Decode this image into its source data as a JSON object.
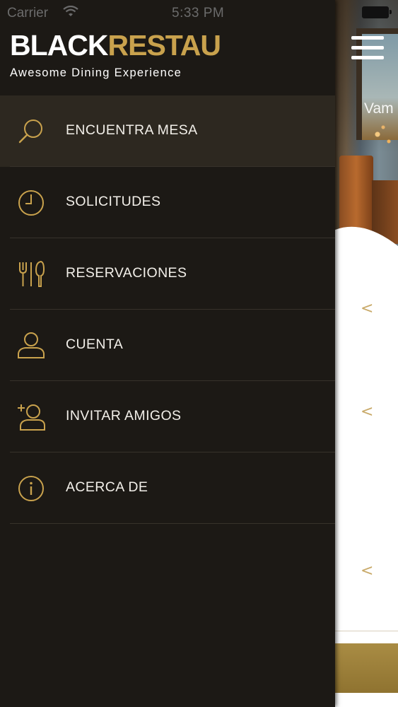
{
  "status_bar": {
    "carrier": "Carrier",
    "time": "5:33 PM"
  },
  "brand": {
    "logo_part1": "BLACK",
    "logo_part2": "RESTAU",
    "tagline": "Awesome Dining Experience",
    "colors": {
      "white": "#ffffff",
      "gold": "#c9a24d"
    }
  },
  "menu": {
    "items": [
      {
        "label": "ENCUENTRA MESA",
        "icon": "search-icon",
        "active": true
      },
      {
        "label": "SOLICITUDES",
        "icon": "clock-icon",
        "active": false
      },
      {
        "label": "RESERVACIONES",
        "icon": "utensils-icon",
        "active": false
      },
      {
        "label": "CUENTA",
        "icon": "user-icon",
        "active": false
      },
      {
        "label": "INVITAR AMIGOS",
        "icon": "add-user-icon",
        "active": false
      },
      {
        "label": "ACERCA DE",
        "icon": "info-icon",
        "active": false
      }
    ]
  },
  "background": {
    "hero_text": "Vam",
    "chevron": "<"
  },
  "colors": {
    "drawer_bg": "#1c1915",
    "active_item_bg": "#2d2820",
    "accent_gold": "#c9a24d",
    "menu_text": "#f2efe9"
  }
}
